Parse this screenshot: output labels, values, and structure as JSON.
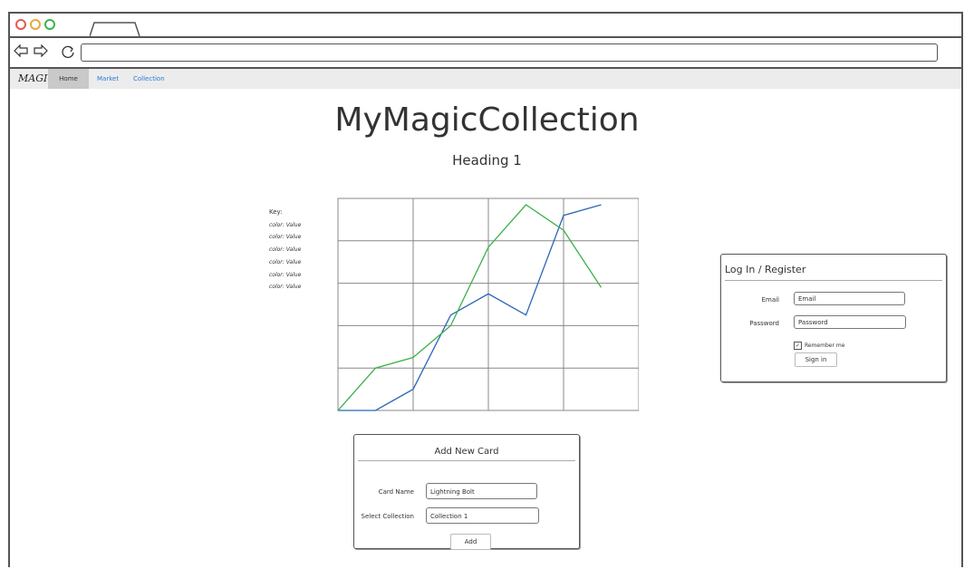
{
  "nav": {
    "brand": "MAGIC",
    "items": [
      {
        "label": "Home",
        "active": true
      },
      {
        "label": "Market",
        "active": false
      },
      {
        "label": "Collection",
        "active": false
      }
    ]
  },
  "page": {
    "title": "MyMagicCollection",
    "heading": "Heading 1"
  },
  "key": {
    "title": "Key:",
    "items": [
      "color: Value",
      "color: Value",
      "color: Value",
      "color: Value",
      "color: Value",
      "color: Value"
    ]
  },
  "chart_data": {
    "type": "line",
    "x": [
      0,
      1,
      2,
      3,
      4,
      5,
      6,
      7,
      8
    ],
    "series": [
      {
        "color": "#2a66b8",
        "values": [
          0,
          0,
          10,
          45,
          55,
          45,
          92,
          97,
          null
        ]
      },
      {
        "color": "#3cb04a",
        "values": [
          0,
          20,
          25,
          40,
          77,
          97,
          85,
          58,
          null
        ]
      }
    ],
    "grid": true,
    "columns": 4,
    "rows": 5
  },
  "login": {
    "title": "Log In / Register",
    "email_label": "Email",
    "email_value": "Email",
    "password_label": "Password",
    "password_value": "Password",
    "remember_label": "Remember me",
    "remember_checked": true,
    "signin_label": "Sign in"
  },
  "addcard": {
    "title": "Add New Card",
    "card_name_label": "Card Name",
    "card_name_value": "Lightning Bolt",
    "select_label": "Select Collection",
    "select_value": "Collection 1",
    "add_label": "Add"
  },
  "colors": {
    "link": "#2b7bd6",
    "series_blue": "#2a66b8",
    "series_green": "#3cb04a"
  }
}
